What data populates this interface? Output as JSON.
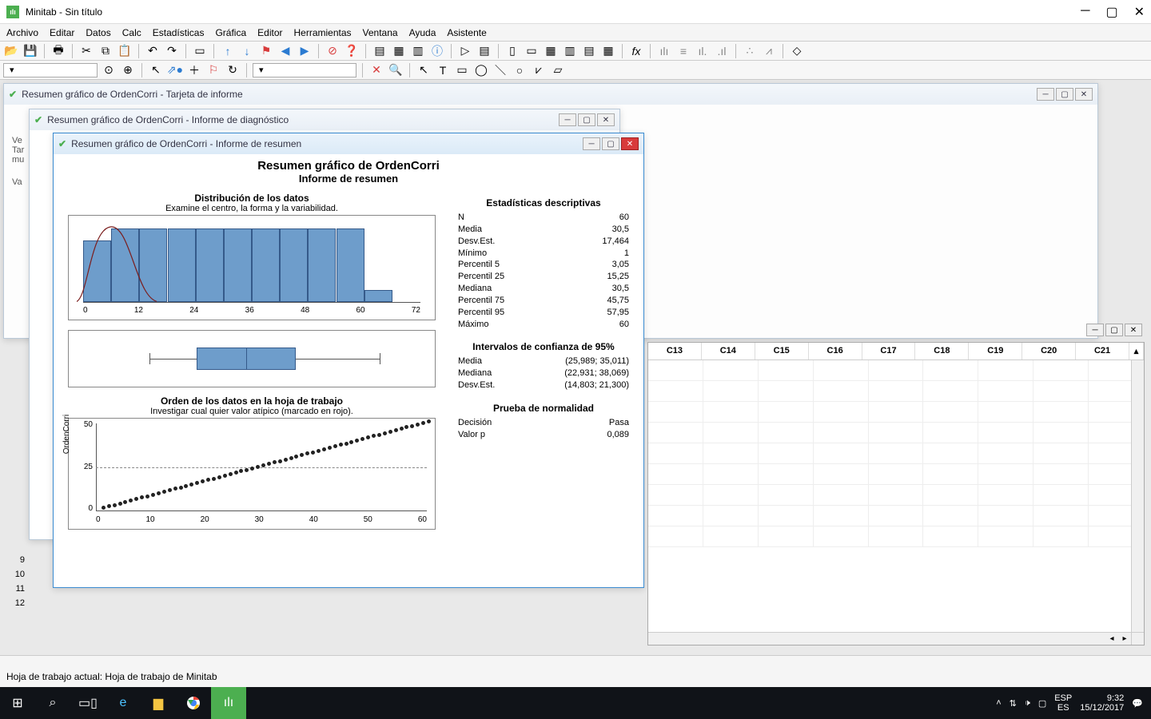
{
  "app": {
    "title": "Minitab - Sin título"
  },
  "menu": [
    "Archivo",
    "Editar",
    "Datos",
    "Calc",
    "Estadísticas",
    "Gráfica",
    "Editor",
    "Herramientas",
    "Ventana",
    "Ayuda",
    "Asistente"
  ],
  "mdi": {
    "back1_title": "Resumen gráfico de OrdenCorri - Tarjeta de informe",
    "back2_title": "Resumen gráfico de OrdenCorri - Informe de diagnóstico",
    "front_title": "Resumen gráfico de OrdenCorri - Informe de resumen"
  },
  "report": {
    "title": "Resumen gráfico de OrdenCorri",
    "subtitle": "Informe de resumen",
    "hist_title": "Distribución de los datos",
    "hist_sub": "Examine el centro, la forma y la variabilidad.",
    "order_title": "Orden de los datos en la hoja de trabajo",
    "order_sub": "Investigar cual quier valor atípico (marcado en rojo).",
    "ylab": "OrdenCorri"
  },
  "stats": {
    "hdr": "Estadísticas descriptivas",
    "rows": [
      {
        "k": "N",
        "v": "60"
      },
      {
        "k": "Media",
        "v": "30,5"
      },
      {
        "k": "Desv.Est.",
        "v": "17,464"
      },
      {
        "k": "Mínimo",
        "v": "1"
      },
      {
        "k": "Percentil 5",
        "v": "3,05"
      },
      {
        "k": "Percentil 25",
        "v": "15,25"
      },
      {
        "k": "Mediana",
        "v": "30,5"
      },
      {
        "k": "Percentil 75",
        "v": "45,75"
      },
      {
        "k": "Percentil 95",
        "v": "57,95"
      },
      {
        "k": "Máximo",
        "v": "60"
      }
    ],
    "ci_hdr": "Intervalos de confianza de 95%",
    "ci": [
      {
        "k": "Media",
        "v": "(25,989; 35,011)"
      },
      {
        "k": "Mediana",
        "v": "(22,931; 38,069)"
      },
      {
        "k": "Desv.Est.",
        "v": "(14,803; 21,300)"
      }
    ],
    "norm_hdr": "Prueba de normalidad",
    "norm": [
      {
        "k": "Decisión",
        "v": "Pasa"
      },
      {
        "k": "Valor p",
        "v": "0,089"
      }
    ]
  },
  "chart_data": [
    {
      "type": "bar",
      "title": "Distribución de los datos",
      "categories": [
        0,
        6,
        12,
        18,
        24,
        30,
        36,
        42,
        48,
        54,
        60,
        66
      ],
      "bin_edges": [
        0,
        6,
        12,
        18,
        24,
        30,
        36,
        42,
        48,
        54,
        60,
        66
      ],
      "values": [
        5,
        6,
        6,
        6,
        6,
        6,
        6,
        6,
        6,
        6,
        1
      ],
      "xlabel": "",
      "ylabel": "",
      "xlim": [
        0,
        72
      ],
      "overlay_curve": "normal(mean=30.5, sd=17.464)"
    },
    {
      "type": "boxplot",
      "min": 1,
      "q1": 15.25,
      "median": 30.5,
      "q3": 45.75,
      "max": 60
    },
    {
      "type": "scatter",
      "title": "Orden de los datos en la hoja de trabajo",
      "x": [
        1,
        2,
        3,
        4,
        5,
        6,
        7,
        8,
        9,
        10,
        11,
        12,
        13,
        14,
        15,
        16,
        17,
        18,
        19,
        20,
        21,
        22,
        23,
        24,
        25,
        26,
        27,
        28,
        29,
        30,
        31,
        32,
        33,
        34,
        35,
        36,
        37,
        38,
        39,
        40,
        41,
        42,
        43,
        44,
        45,
        46,
        47,
        48,
        49,
        50,
        51,
        52,
        53,
        54,
        55,
        56,
        57,
        58,
        59,
        60
      ],
      "y": [
        1,
        2,
        3,
        4,
        5,
        6,
        7,
        8,
        9,
        10,
        11,
        12,
        13,
        14,
        15,
        16,
        17,
        18,
        19,
        20,
        21,
        22,
        23,
        24,
        25,
        26,
        27,
        28,
        29,
        30,
        31,
        32,
        33,
        34,
        35,
        36,
        37,
        38,
        39,
        40,
        41,
        42,
        43,
        44,
        45,
        46,
        47,
        48,
        49,
        50,
        51,
        52,
        53,
        54,
        55,
        56,
        57,
        58,
        59,
        60
      ],
      "xlabel": "",
      "ylabel": "OrdenCorri",
      "xticks": [
        0,
        10,
        20,
        30,
        40,
        50,
        60
      ],
      "yticks": [
        0,
        25,
        50
      ],
      "ref_line": 30.5
    }
  ],
  "sheet": {
    "cols": [
      "C13",
      "C14",
      "C15",
      "C16",
      "C17",
      "C18",
      "C19",
      "C20",
      "C21"
    ]
  },
  "session": {
    "l1": "Ve",
    "l2a": "Tar",
    "l2b": "mu",
    "l3": "Va"
  },
  "rownums": [
    "9",
    "10",
    "11",
    "12"
  ],
  "status": "Hoja de trabajo actual: Hoja de trabajo de Minitab",
  "tray": {
    "lang": "ESP",
    "kbd": "ES",
    "time": "9:32",
    "date": "15/12/2017"
  }
}
